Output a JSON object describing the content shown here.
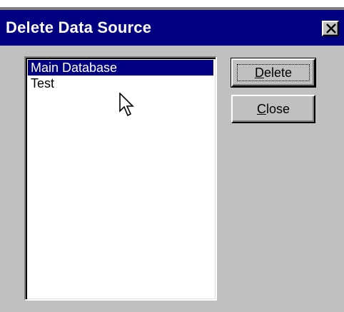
{
  "window": {
    "title": "Delete Data Source",
    "title_bar_color": "#000080",
    "close_icon": "close-icon"
  },
  "listbox": {
    "items": [
      {
        "label": "Main Database",
        "selected": true
      },
      {
        "label": "Test",
        "selected": false
      }
    ]
  },
  "buttons": {
    "delete": {
      "mnemonic": "D",
      "rest": "elete"
    },
    "close": {
      "mnemonic": "C",
      "rest": "lose"
    }
  },
  "cursor_icon": "mouse-pointer-icon"
}
